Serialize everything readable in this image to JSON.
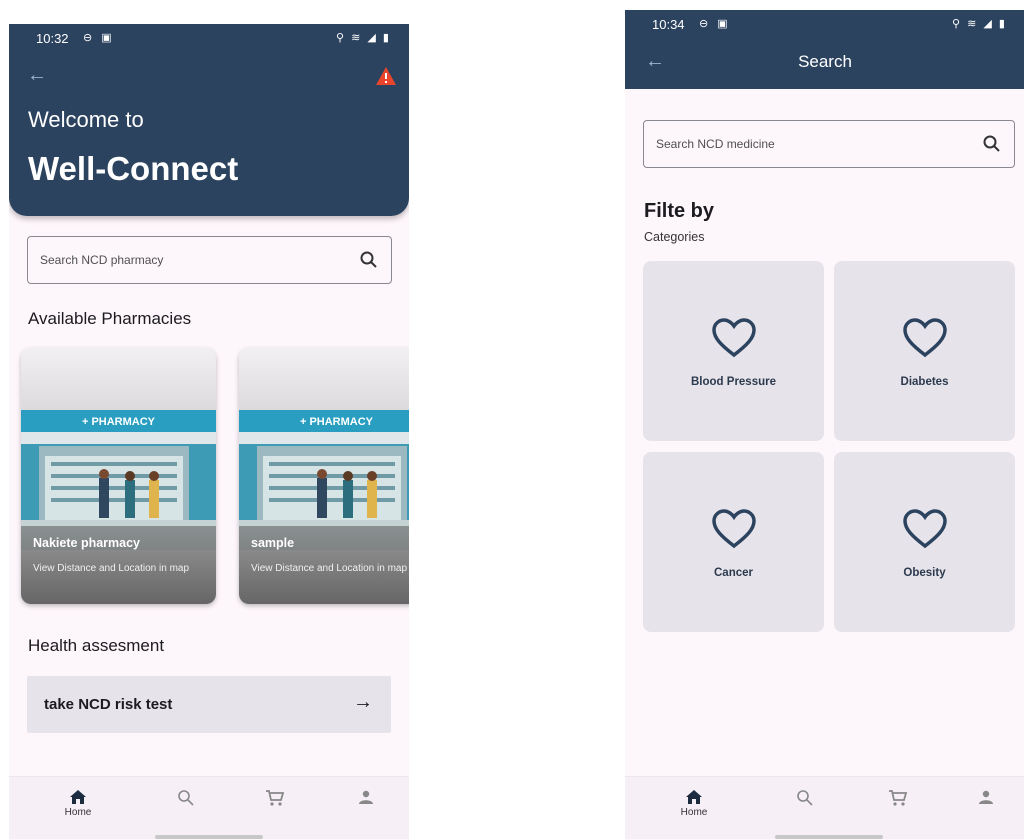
{
  "colors": {
    "header": "#2c4360",
    "background": "#fdf6fb",
    "card": "#e6e3ea",
    "warning": "#e8452c"
  },
  "screen1": {
    "status": {
      "time": "10:32"
    },
    "header": {
      "welcome": "Welcome to",
      "title": "Well-Connect"
    },
    "search": {
      "placeholder": "Search NCD pharmacy"
    },
    "pharmacies_title": "Available Pharmacies",
    "pharmacies": [
      {
        "sign": "+ PHARMACY",
        "name": "Nakiete pharmacy",
        "subtitle": "View Distance and Location in map"
      },
      {
        "sign": "+ PHARMACY",
        "name": "sample",
        "subtitle": "View Distance and Location in map"
      }
    ],
    "health_title": "Health assesment",
    "risk_test": {
      "label": "take NCD risk test",
      "icon": "arrow-right-icon"
    },
    "nav": [
      {
        "label": "Home",
        "icon": "home-icon"
      },
      {
        "label": "",
        "icon": "search-icon"
      },
      {
        "label": "",
        "icon": "cart-icon"
      },
      {
        "label": "",
        "icon": "person-icon"
      }
    ]
  },
  "screen2": {
    "status": {
      "time": "10:34"
    },
    "header": {
      "title": "Search"
    },
    "search": {
      "placeholder": "Search NCD medicine"
    },
    "filter_title": "Filte by",
    "filter_subtitle": "Categories",
    "categories": [
      {
        "label": "Blood Pressure",
        "icon": "heart-icon"
      },
      {
        "label": "Diabetes",
        "icon": "heart-icon"
      },
      {
        "label": "Cancer",
        "icon": "heart-icon"
      },
      {
        "label": "Obesity",
        "icon": "heart-icon"
      }
    ],
    "nav": [
      {
        "label": "Home",
        "icon": "home-icon"
      },
      {
        "label": "",
        "icon": "search-icon"
      },
      {
        "label": "",
        "icon": "cart-icon"
      },
      {
        "label": "",
        "icon": "person-icon"
      }
    ]
  }
}
